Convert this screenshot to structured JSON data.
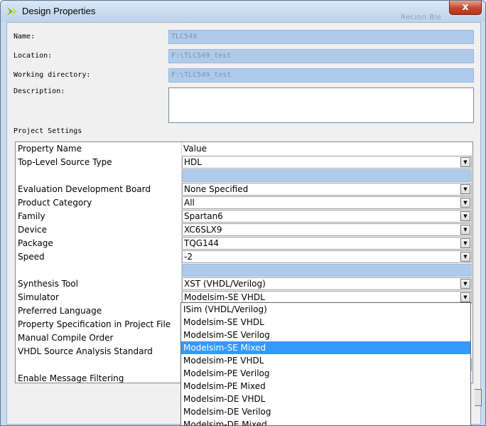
{
  "window": {
    "title": "Design Properties",
    "close_label": "x",
    "background_text": "Recion Ble"
  },
  "general": {
    "name_label": "Name:",
    "name_value": "TLC549",
    "location_label": "Location:",
    "location_value": "F:\\TLC549_test",
    "workdir_label": "Working directory:",
    "workdir_value": "F:\\TLC549_test",
    "description_label": "Description:",
    "description_value": ""
  },
  "project_settings": {
    "section_label": "Project Settings",
    "headers": {
      "property": "Property Name",
      "value": "Value"
    },
    "rows": [
      {
        "name": "Top-Level Source Type",
        "value": "HDL",
        "dropdown": true
      },
      {
        "name": "",
        "value": "",
        "dropdown": false
      },
      {
        "name": "Evaluation Development Board",
        "value": "None Specified",
        "dropdown": true
      },
      {
        "name": "Product Category",
        "value": "All",
        "dropdown": true
      },
      {
        "name": "Family",
        "value": "Spartan6",
        "dropdown": true
      },
      {
        "name": "Device",
        "value": "XC6SLX9",
        "dropdown": true
      },
      {
        "name": "Package",
        "value": "TQG144",
        "dropdown": true
      },
      {
        "name": "Speed",
        "value": "-2",
        "dropdown": true
      },
      {
        "name": "",
        "value": "",
        "dropdown": false
      },
      {
        "name": "Synthesis Tool",
        "value": "XST (VHDL/Verilog)",
        "dropdown": true
      },
      {
        "name": "Simulator",
        "value": "Modelsim-SE VHDL",
        "dropdown": true
      },
      {
        "name": "Preferred Language",
        "value": "",
        "dropdown": false
      },
      {
        "name": "Property Specification in Project File",
        "value": "",
        "dropdown": false
      },
      {
        "name": "Manual Compile Order",
        "value": "",
        "dropdown": false
      },
      {
        "name": "VHDL Source Analysis Standard",
        "value": "",
        "dropdown": false
      },
      {
        "name": "",
        "value": "",
        "dropdown": false
      },
      {
        "name": "Enable Message Filtering",
        "value": "",
        "dropdown": false
      }
    ]
  },
  "simulator_dropdown": {
    "options": [
      "ISim (VHDL/Verilog)",
      "Modelsim-SE VHDL",
      "Modelsim-SE Verilog",
      "Modelsim-SE Mixed",
      "Modelsim-PE VHDL",
      "Modelsim-PE Verilog",
      "Modelsim-PE Mixed",
      "Modelsim-DE VHDL",
      "Modelsim-DE Verilog",
      "Modelsim-DE Mixed"
    ],
    "highlighted": "Modelsim-SE Mixed"
  },
  "colors": {
    "selection": "#3399ff",
    "field_bg": "#aecbec"
  }
}
